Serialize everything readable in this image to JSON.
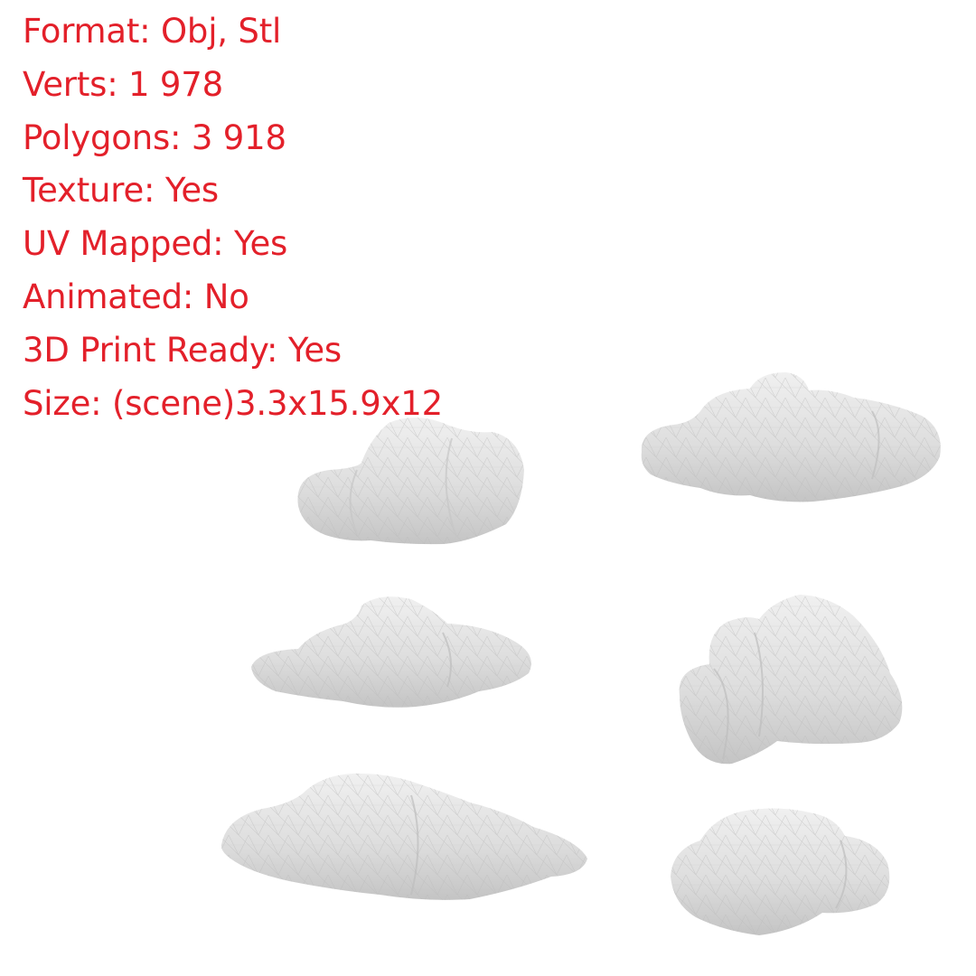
{
  "specs": {
    "format": "Format: Obj, Stl",
    "verts": "Verts: 1 978",
    "polygons": "Polygons: 3 918",
    "texture": "Texture: Yes",
    "uv_mapped": "UV Mapped: Yes",
    "animated": "Animated: No",
    "print_ready": "3D Print Ready: Yes",
    "size": "Size: (scene)3.3x15.9x12"
  },
  "colors": {
    "text": "#e3202a",
    "background": "#ffffff",
    "cloud_light": "#ececec",
    "cloud_mid": "#d9d9d9",
    "cloud_shadow": "#bdbdbd"
  },
  "scene": {
    "subject": "low-poly-clouds",
    "cloud_count": 6
  }
}
